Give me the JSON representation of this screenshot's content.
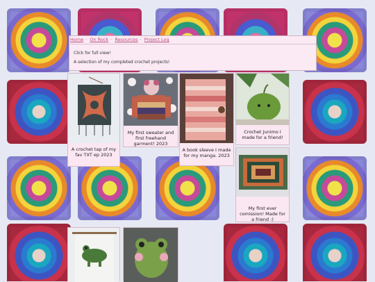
{
  "nav": {
    "items": [
      "Home",
      "On Rock",
      "Resources",
      "Project Log"
    ]
  },
  "intro": {
    "hint": "Click for full view!",
    "description": "A selection of my completed crochet projects!"
  },
  "gallery": [
    {
      "caption": "A crochet tap of my fav TXT ep 2023",
      "icon": "tapestry-photo"
    },
    {
      "caption": "My first sweater and first freehand garment! 2023",
      "icon": "sweater-photo"
    },
    {
      "caption": "A book sleeve I made for my manga. 2023",
      "icon": "book-sleeve-photo"
    },
    {
      "caption": "Crochet Junimo I made for a friend!",
      "icon": "junimo-photo"
    },
    {
      "caption": "My first ever comission! Made for a friend :)",
      "icon": "blanket-photo"
    },
    {
      "caption": "",
      "icon": "frog-tapestry-photo"
    },
    {
      "caption": "",
      "icon": "frog-plush-photo"
    }
  ],
  "colors": {
    "accent": "#b64b7f",
    "panel": "#fbe7f2"
  }
}
